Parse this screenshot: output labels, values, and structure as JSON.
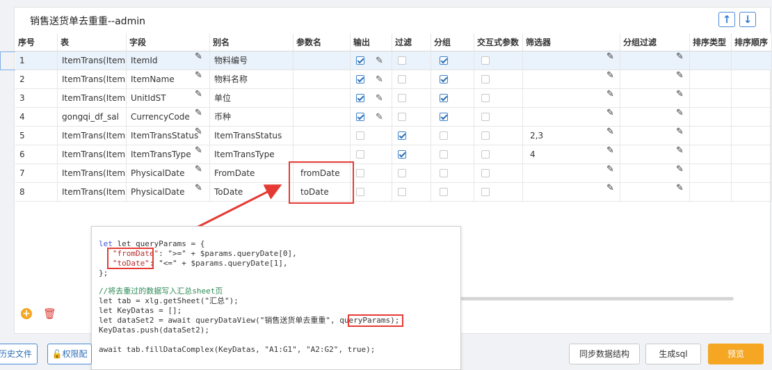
{
  "title": "销售送货单去重重--admin",
  "columns": [
    "序号",
    "表",
    "字段",
    "别名",
    "参数名",
    "输出",
    "过滤",
    "分组",
    "交互式参数",
    "筛选器",
    "分组过滤",
    "排序类型",
    "排序顺序"
  ],
  "rows": [
    {
      "no": "1",
      "table": "ItemTrans(Item",
      "field": "ItemId",
      "alias": "物料编号",
      "param": "",
      "output": true,
      "filter": false,
      "group": true,
      "inter": false,
      "screener": ""
    },
    {
      "no": "2",
      "table": "ItemTrans(Item",
      "field": "ItemName",
      "alias": "物料名称",
      "param": "",
      "output": true,
      "filter": false,
      "group": true,
      "inter": false,
      "screener": ""
    },
    {
      "no": "3",
      "table": "ItemTrans(Item",
      "field": "UnitIdST",
      "alias": "单位",
      "param": "",
      "output": true,
      "filter": false,
      "group": true,
      "inter": false,
      "screener": ""
    },
    {
      "no": "4",
      "table": "gongqi_df_sal",
      "field": "CurrencyCode",
      "alias": "币种",
      "param": "",
      "output": true,
      "filter": false,
      "group": true,
      "inter": false,
      "screener": ""
    },
    {
      "no": "5",
      "table": "ItemTrans(Item",
      "field": "ItemTransStatus",
      "alias": "ItemTransStatus",
      "param": "",
      "output": false,
      "filter": true,
      "group": false,
      "inter": false,
      "screener": "2,3"
    },
    {
      "no": "6",
      "table": "ItemTrans(Item",
      "field": "ItemTransType",
      "alias": "ItemTransType",
      "param": "",
      "output": false,
      "filter": true,
      "group": false,
      "inter": false,
      "screener": "4"
    },
    {
      "no": "7",
      "table": "ItemTrans(Item",
      "field": "PhysicalDate",
      "alias": "FromDate",
      "param": "fromDate",
      "output": false,
      "filter": false,
      "group": false,
      "inter": false,
      "screener": ""
    },
    {
      "no": "8",
      "table": "ItemTrans(Item",
      "field": "PhysicalDate",
      "alias": "ToDate",
      "param": "toDate",
      "output": false,
      "filter": false,
      "group": false,
      "inter": false,
      "screener": ""
    }
  ],
  "code": {
    "l1": "let queryParams = {",
    "l2a": "\"fromDate\"",
    "l2b": ": \">=\" + $params.queryDate[0],",
    "l3a": "\"toDate\"",
    "l3b": ": \"<=\" + $params.queryDate[1],",
    "l4": "};",
    "l5": "//将去重过的数据写入汇总sheet页",
    "l6": "let tab = xlg.getSheet(\"汇总\");",
    "l7": "let KeyDatas = [];",
    "l8a": "let dataSet2 = await queryDataView(\"销售送货单去重重\", ",
    "l8b": "queryParams",
    "l8c": ");",
    "l9": "KeyDatas.push(dataSet2);",
    "l10": "await tab.fillDataComplex(KeyDatas, \"A1:G1\", \"A2:G2\", true);"
  },
  "footer": {
    "history": "历史文件",
    "perm": "权限配",
    "sync": "同步数据结构",
    "gensql": "生成sql",
    "preview": "预览"
  },
  "colors": {
    "accent": "#2f7ad8",
    "highlight": "#e53a33",
    "primary": "#f5a623"
  }
}
